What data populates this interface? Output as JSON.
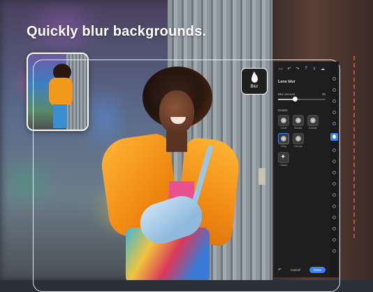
{
  "headline": "Quickly blur backgrounds.",
  "blur_badge": {
    "icon": "droplet-icon",
    "label": "Blur"
  },
  "panel": {
    "toolbar_icons": [
      "sidebar-icon",
      "undo-icon",
      "redo-icon",
      "help-icon",
      "share-icon",
      "cloud-icon"
    ],
    "title": "Lens blur",
    "blur_amount_label": "Blur amount",
    "blur_amount_value": "35",
    "blur_amount_fraction": 0.35,
    "section_label": "Details",
    "effects": [
      {
        "name": "Circle",
        "selected": false
      },
      {
        "name": "Bubble",
        "selected": false
      },
      {
        "name": "5-blade",
        "selected": false
      },
      {
        "name": "Ring",
        "selected": true
      },
      {
        "name": "Cat eye",
        "selected": false
      }
    ],
    "extra_effect": {
      "name": "Classic"
    },
    "undo_icon": "undo-icon",
    "cancel_label": "Cancel",
    "done_label": "Done"
  },
  "colors": {
    "accent": "#3b82f6",
    "panel_bg": "#1e1e1e",
    "jacket": "#f39a1c"
  }
}
